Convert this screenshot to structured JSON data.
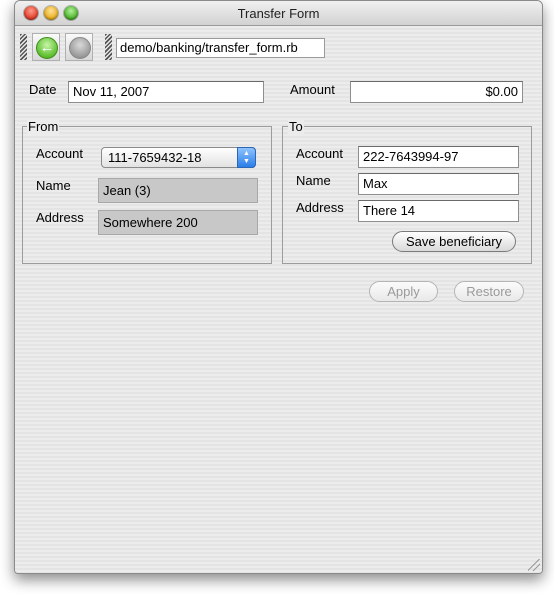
{
  "window": {
    "title": "Transfer Form"
  },
  "toolbar": {
    "path": "demo/banking/transfer_form.rb"
  },
  "form": {
    "date_label": "Date",
    "date_value": "Nov 11, 2007",
    "amount_label": "Amount",
    "amount_value": "$0.00"
  },
  "from": {
    "legend": "From",
    "account_label": "Account",
    "account_value": "111-7659432-18",
    "name_label": "Name",
    "name_value": "Jean (3)",
    "address_label": "Address",
    "address_value": "Somewhere 200"
  },
  "to": {
    "legend": "To",
    "account_label": "Account",
    "account_value": "222-7643994-97",
    "name_label": "Name",
    "name_value": "Max",
    "address_label": "Address",
    "address_value": "There 14",
    "save_label": "Save beneficiary"
  },
  "actions": {
    "apply_label": "Apply",
    "restore_label": "Restore"
  },
  "icons": {
    "back": "back-arrow-icon",
    "forward": "forward-icon",
    "dropdown": "updown-chevron-icon",
    "resize": "resize-grip-icon"
  },
  "colors": {
    "back_button": "#5dbf2f",
    "select_stepper": "#2a7ee8",
    "readonly_field": "#c8c8c8"
  }
}
